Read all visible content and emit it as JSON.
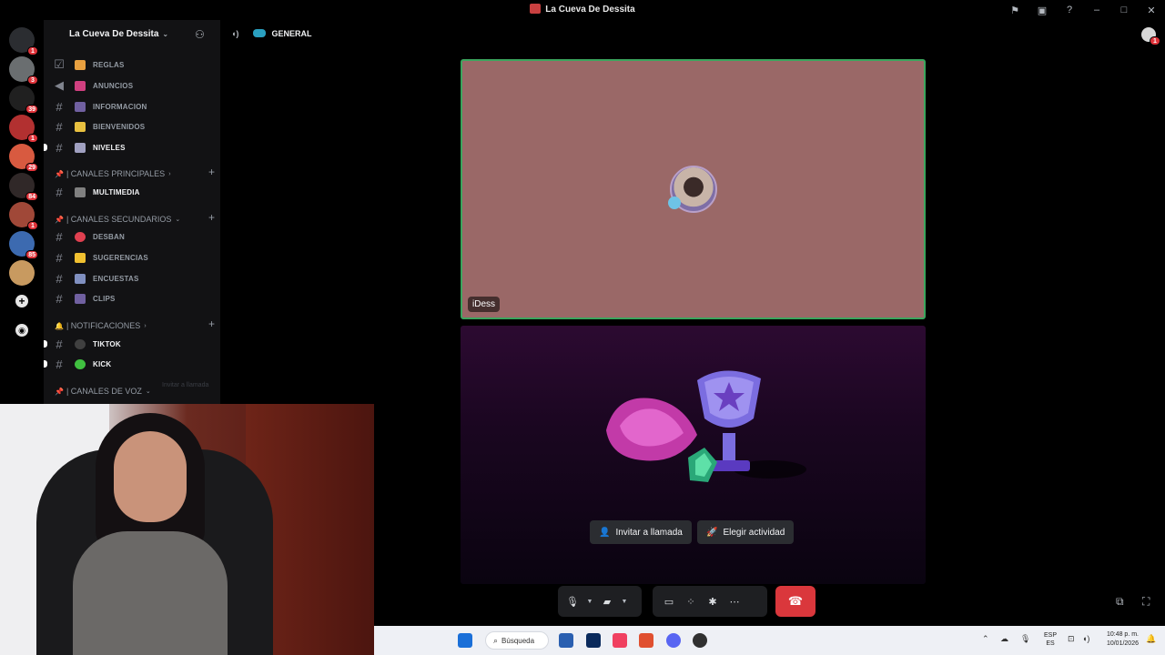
{
  "window": {
    "title": "La Cueva De Dessita"
  },
  "server": {
    "name": "La Cueva De Dessita"
  },
  "guild_badges": [
    "1",
    "3",
    "39",
    "1",
    "29",
    "84",
    "1",
    "85"
  ],
  "channels_top": [
    {
      "name": "REGLAS",
      "icon": "checkbox-icon",
      "emoji_color": "#e8a040",
      "unread": false
    },
    {
      "name": "ANUNCIOS",
      "icon": "megaphone-icon",
      "emoji_color": "#d04080",
      "unread": false
    },
    {
      "name": "INFORMACION",
      "icon": "hash-icon",
      "emoji_color": "#7060a0",
      "unread": false
    },
    {
      "name": "BIENVENIDOS",
      "icon": "hash-icon",
      "emoji_color": "#e8c040",
      "unread": false
    },
    {
      "name": "NIVELES",
      "icon": "hash-icon",
      "emoji_color": "#a0a0c0",
      "unread": true
    }
  ],
  "cat_principales": {
    "label": "| CANALES PRINCIPALES"
  },
  "ch_multimedia": {
    "name": "MULTIMEDIA",
    "emoji_color": "#808080"
  },
  "cat_secundarios": {
    "label": "| CANALES SECUNDARIOS"
  },
  "channels_sec": [
    {
      "name": "DESBAN",
      "emoji_color": "#e04050"
    },
    {
      "name": "SUGERENCIAS",
      "emoji_color": "#f0c030"
    },
    {
      "name": "ENCUESTAS",
      "emoji_color": "#8090c0"
    },
    {
      "name": "CLIPS",
      "emoji_color": "#7060a0"
    }
  ],
  "cat_notificaciones": {
    "label": "| NOTIFICACIONES"
  },
  "channels_notif": [
    {
      "name": "TIKTOK",
      "emoji_color": "#404040"
    },
    {
      "name": "KICK",
      "emoji_color": "#40c040"
    }
  ],
  "cat_voz": {
    "label": "| CANALES DE VOZ"
  },
  "ghost_tooltip": "Invitar a llamada",
  "voice_channel": {
    "name": "GENERAL"
  },
  "participant": {
    "name": "iDess"
  },
  "activity": {
    "invite_label": "Invitar a llamada",
    "activity_label": "Elegir actividad"
  },
  "colors": {
    "speaking_border": "#3ba55d",
    "tile_bg": "#9a6867",
    "hangup": "#da373c"
  },
  "taskbar": {
    "search_placeholder": "Búsqueda",
    "lang_top": "ESP",
    "lang_bottom": "ES",
    "time": "10:48 p. m.",
    "date": "10/01/2026"
  }
}
